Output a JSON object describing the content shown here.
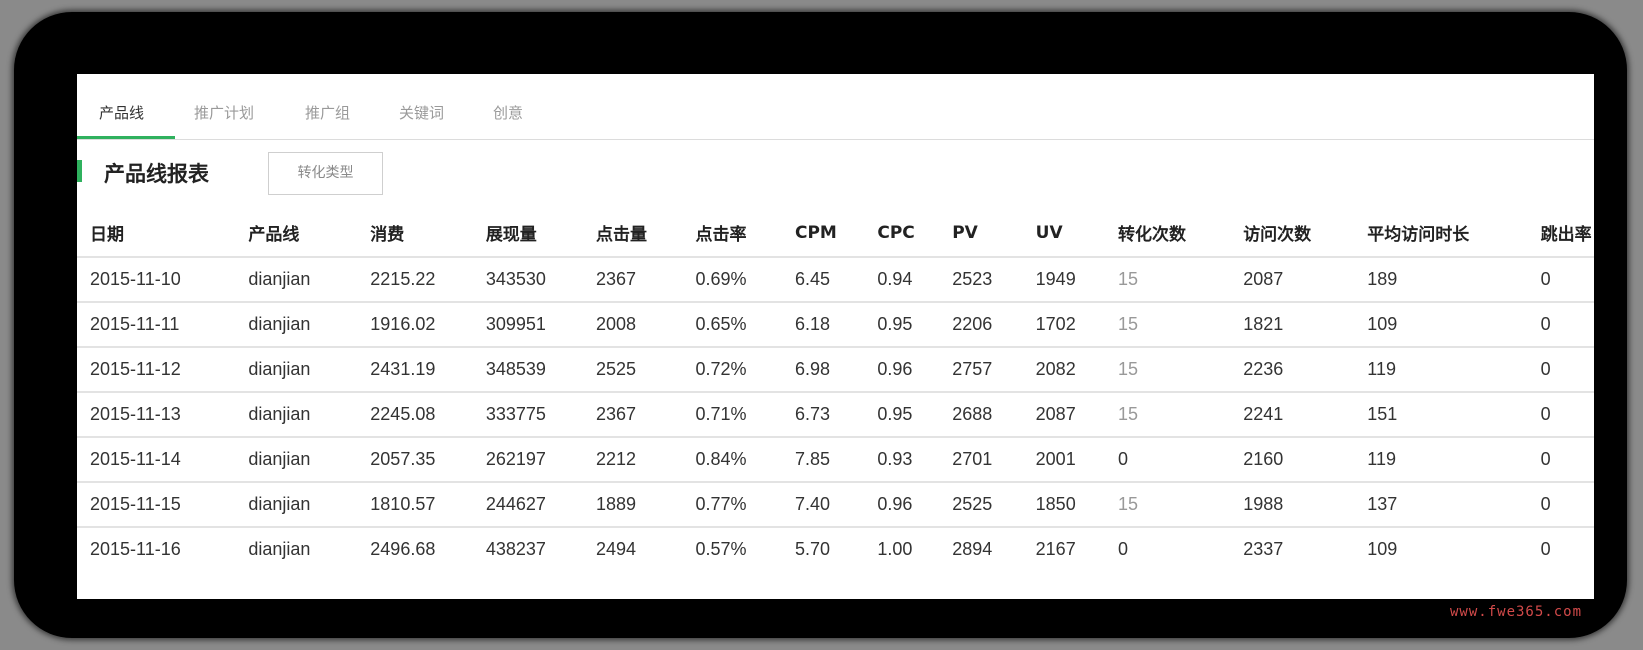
{
  "tabs": [
    {
      "label": "产品线",
      "active": true
    },
    {
      "label": "推广计划",
      "active": false
    },
    {
      "label": "推广组",
      "active": false
    },
    {
      "label": "关键词",
      "active": false
    },
    {
      "label": "创意",
      "active": false
    }
  ],
  "report": {
    "title": "产品线报表",
    "conversion_type_button": "转化类型"
  },
  "table": {
    "columns": [
      "日期",
      "产品线",
      "消费",
      "展现量",
      "点击量",
      "点击率",
      "CPM",
      "CPC",
      "PV",
      "UV",
      "转化次数",
      "访问次数",
      "平均访问时长",
      "跳出率"
    ],
    "rows": [
      [
        "2015-11-10",
        "dianjian",
        "2215.22",
        "343530",
        "2367",
        "0.69%",
        "6.45",
        "0.94",
        "2523",
        "1949",
        "15",
        "2087",
        "189",
        "0"
      ],
      [
        "2015-11-11",
        "dianjian",
        "1916.02",
        "309951",
        "2008",
        "0.65%",
        "6.18",
        "0.95",
        "2206",
        "1702",
        "15",
        "1821",
        "109",
        "0"
      ],
      [
        "2015-11-12",
        "dianjian",
        "2431.19",
        "348539",
        "2525",
        "0.72%",
        "6.98",
        "0.96",
        "2757",
        "2082",
        "15",
        "2236",
        "119",
        "0"
      ],
      [
        "2015-11-13",
        "dianjian",
        "2245.08",
        "333775",
        "2367",
        "0.71%",
        "6.73",
        "0.95",
        "2688",
        "2087",
        "15",
        "2241",
        "151",
        "0"
      ],
      [
        "2015-11-14",
        "dianjian",
        "2057.35",
        "262197",
        "2212",
        "0.84%",
        "7.85",
        "0.93",
        "2701",
        "2001",
        "0",
        "2160",
        "119",
        "0"
      ],
      [
        "2015-11-15",
        "dianjian",
        "1810.57",
        "244627",
        "1889",
        "0.77%",
        "7.40",
        "0.96",
        "2525",
        "1850",
        "15",
        "1988",
        "137",
        "0"
      ],
      [
        "2015-11-16",
        "dianjian",
        "2496.68",
        "438237",
        "2494",
        "0.57%",
        "5.70",
        "1.00",
        "2894",
        "2167",
        "0",
        "2337",
        "109",
        "0"
      ]
    ]
  },
  "watermark": "www.fwe365.com",
  "colors": {
    "accent": "#2fb15e",
    "frame": "#000000",
    "background": "#8a8a8a"
  }
}
